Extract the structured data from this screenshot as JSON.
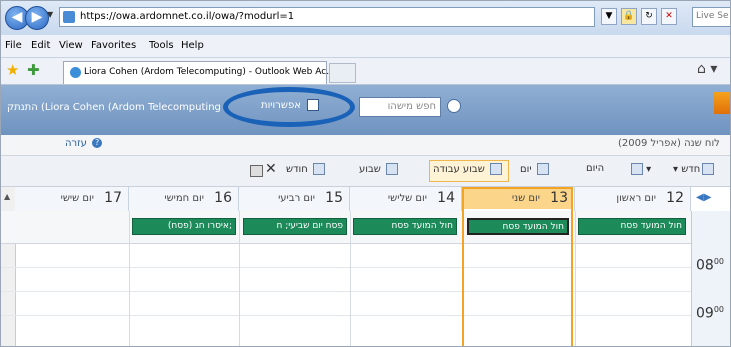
{
  "browser": {
    "url": "https://owa.ardomnet.co.il/owa/?modurl=1",
    "search_placeholder": "Live Se",
    "tab_title": "Liora Cohen (Ardom Telecomputing) - Outlook Web Ac...",
    "menu": [
      {
        "label": "File",
        "key": "F"
      },
      {
        "label": "Edit",
        "key": "E"
      },
      {
        "label": "View",
        "key": "V"
      },
      {
        "label": "Favorites",
        "key": "a"
      },
      {
        "label": "Tools",
        "key": "T"
      },
      {
        "label": "Help",
        "key": "H"
      }
    ]
  },
  "owa": {
    "logout": "התנתק",
    "user": "(Liora Cohen (Ardom Telecomputing",
    "options": "אפשרויות",
    "search_placeholder": "חפש מישהו",
    "help": "עזרה",
    "calendar_title": "לוח שנה (אפריל 2009)"
  },
  "toolbar": {
    "new": "חדש",
    "today": "היום",
    "day": "יום",
    "work_week": "שבוע עבודה",
    "week": "שבוע",
    "month": "חודש"
  },
  "days": [
    {
      "num": "12",
      "name": "יום ראשון",
      "event": "חול המועד פסח"
    },
    {
      "num": "13",
      "name": "יום שני",
      "event": "חול המועד פסח"
    },
    {
      "num": "14",
      "name": "יום שלישי",
      "event": "חול המועד פסח"
    },
    {
      "num": "15",
      "name": "יום רביעי",
      "event": "פסח יום שביעי; ח"
    },
    {
      "num": "16",
      "name": "יום חמישי",
      "event": "איסרו חג (פסח);"
    },
    {
      "num": "17",
      "name": "יום שישי",
      "event": ""
    }
  ],
  "times": [
    {
      "hour": "08",
      "min": "00"
    },
    {
      "hour": "09",
      "min": "00"
    }
  ]
}
